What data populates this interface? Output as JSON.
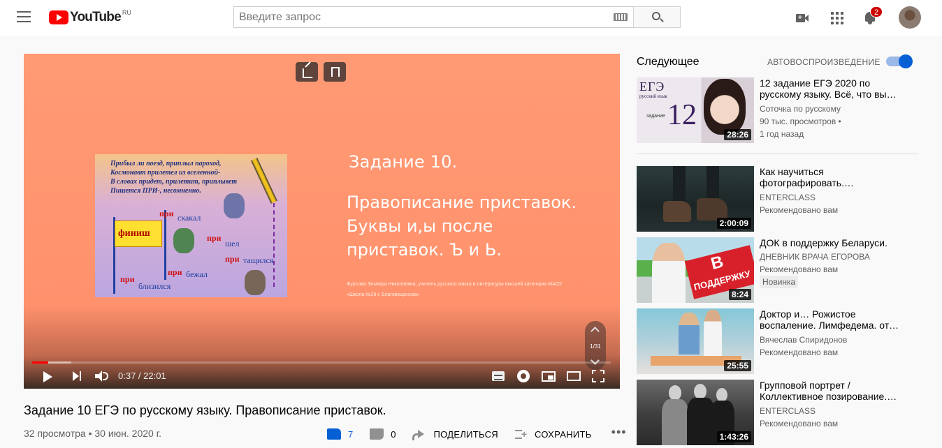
{
  "header": {
    "logo_text": "YouTube",
    "region": "RU",
    "search_placeholder": "Введите запрос",
    "notifications_count": "2"
  },
  "player": {
    "slide": {
      "title": "Задание 10.",
      "subtitle": "Правописание приставок. Буквы и,ы после приставок. Ъ и Ь.",
      "author": "Фурсова Эльвира Николаевна, учитель русского языка и литературы высшей категории МАОУ «Школа №26 г. Благовещенска»",
      "poem_lines": [
        "Прибыл ли поезд, приплыл пароход,",
        "Космонавт прилетел из вселенной-",
        "В словах придет, прилетит, приплывет",
        "Пишется ПРИ-, несомненно."
      ],
      "picture_words": [
        "финиш",
        "при",
        "скакал",
        "при",
        "шел",
        "при",
        "тащился",
        "при",
        "бежал",
        "при",
        "близился"
      ]
    },
    "chapter_counter": "1/31",
    "current_time": "0:37",
    "duration": "22:01",
    "time_display": "0:37 / 22:01",
    "played_fraction": 0.028,
    "buffered_fraction": 0.068
  },
  "video": {
    "title": "Задание 10 ЕГЭ по русскому языку. Правописание приставок.",
    "meta": "32 просмотра • 30 июн. 2020 г.",
    "likes": "7",
    "dislikes": "0",
    "share_label": "ПОДЕЛИТЬСЯ",
    "save_label": "СОХРАНИТЬ"
  },
  "sidebar": {
    "up_next_label": "Следующее",
    "autoplay_label": "АВТОВОСПРОИЗВЕДЕНИЕ",
    "autoplay_on": true,
    "items": [
      {
        "title": "12 задание ЕГЭ 2020 по русскому языку. Всё, что вы…",
        "channel": "Соточка по русскому",
        "views": "90 тыс. просмотров •",
        "age": "1 год назад",
        "duration": "28:26",
        "thumb_text_ege": "ЕГЭ",
        "thumb_text_rus": "русский язык",
        "thumb_text_zad": "задание",
        "thumb_text_num": "12"
      },
      {
        "title": "Как научиться фотографировать.…",
        "channel": "ENTERCLASS",
        "sub": "Рекомендовано вам",
        "duration": "2:00:09"
      },
      {
        "title": "ДОК в поддержку Беларуси.",
        "channel": "ДНЕВНИК ВРАЧА ЕГОРОВА",
        "sub": "Рекомендовано вам",
        "badge": "Новинка",
        "duration": "8:24",
        "thumb_text_b1": "В",
        "thumb_text_b2": "ПОДДЕРЖКУ"
      },
      {
        "title": "Доктор и… Рожистое воспаление. Лимфедема. от…",
        "channel": "Вячеслав Спиридонов",
        "sub": "Рекомендовано вам",
        "duration": "25:55"
      },
      {
        "title": "Групповой портрет / Коллективное позирование.…",
        "channel": "ENTERCLASS",
        "sub": "Рекомендовано вам",
        "duration": "1:43:26"
      }
    ]
  }
}
